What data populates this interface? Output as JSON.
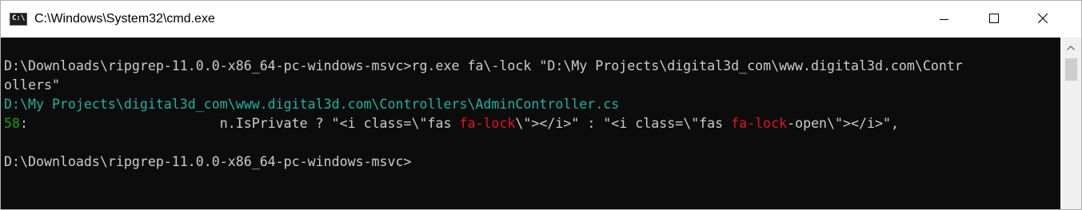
{
  "window": {
    "title": "C:\\Windows\\System32\\cmd.exe",
    "icon": "console-icon",
    "icon_text": "C:\\",
    "controls": {
      "minimize": "minimize-icon",
      "maximize": "maximize-icon",
      "close": "close-icon"
    }
  },
  "colors": {
    "console_background": "#0c0c0c",
    "default_text": "#cccccc",
    "path_text": "#1bb3a3",
    "line_number_text": "#13a10e",
    "match_text": "#e81123"
  },
  "console": {
    "line1": {
      "prompt": "D:\\Downloads\\ripgrep-11.0.0-x86_64-pc-windows-msvc>",
      "command": "rg.exe fa\\-lock \"D:\\My Projects\\digital3d_com\\www.digital3d.com\\Contr"
    },
    "line2": {
      "text": "ollers\""
    },
    "line3": {
      "path": "D:\\My Projects\\digital3d_com\\www.digital3d.com\\Controllers\\AdminController.cs"
    },
    "line4": {
      "line_number": "58",
      "separator": ":",
      "seg1": "                        n.IsPrivate ? \"<i class=\\\"fas ",
      "match1": "fa-lock",
      "seg2": "\\\"></i>\" : \"<i class=\\\"fas ",
      "match2": "fa-lock",
      "seg3": "-open\\\"></i>\","
    },
    "line5": {
      "prompt": "D:\\Downloads\\ripgrep-11.0.0-x86_64-pc-windows-msvc>"
    }
  },
  "scrollbar": {
    "up_arrow": "scroll-up-arrow-icon"
  }
}
